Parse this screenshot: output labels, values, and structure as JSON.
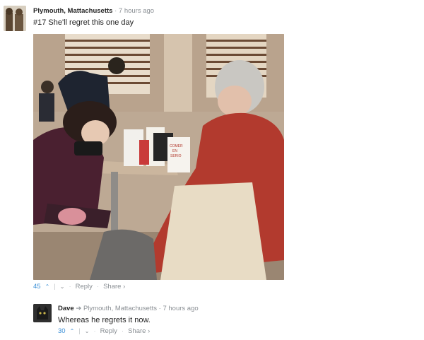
{
  "post": {
    "author": "Plymouth, Mattachusetts",
    "time": "7 hours ago",
    "text": "#17 She'll regret this one day",
    "votes": "45",
    "reply_label": "Reply",
    "share_label": "Share"
  },
  "reply": {
    "author": "Dave",
    "reply_to": "Plymouth, Mattachusetts",
    "time": "7 hours ago",
    "text": "Whereas he regrets it now.",
    "votes": "30",
    "reply_label": "Reply",
    "share_label": "Share"
  },
  "photo": {
    "cup_labels": [
      "COMER EN SERIO"
    ]
  },
  "colors": {
    "accent": "#3a8fd6",
    "meta": "#8a8f94",
    "jacket": "#b23a2e"
  },
  "icons": {
    "upvote": "chevron-up-icon",
    "downvote": "chevron-down-icon",
    "reply_arrow": "reply-arrow-icon",
    "share_arrow": "chevron-right-icon"
  }
}
